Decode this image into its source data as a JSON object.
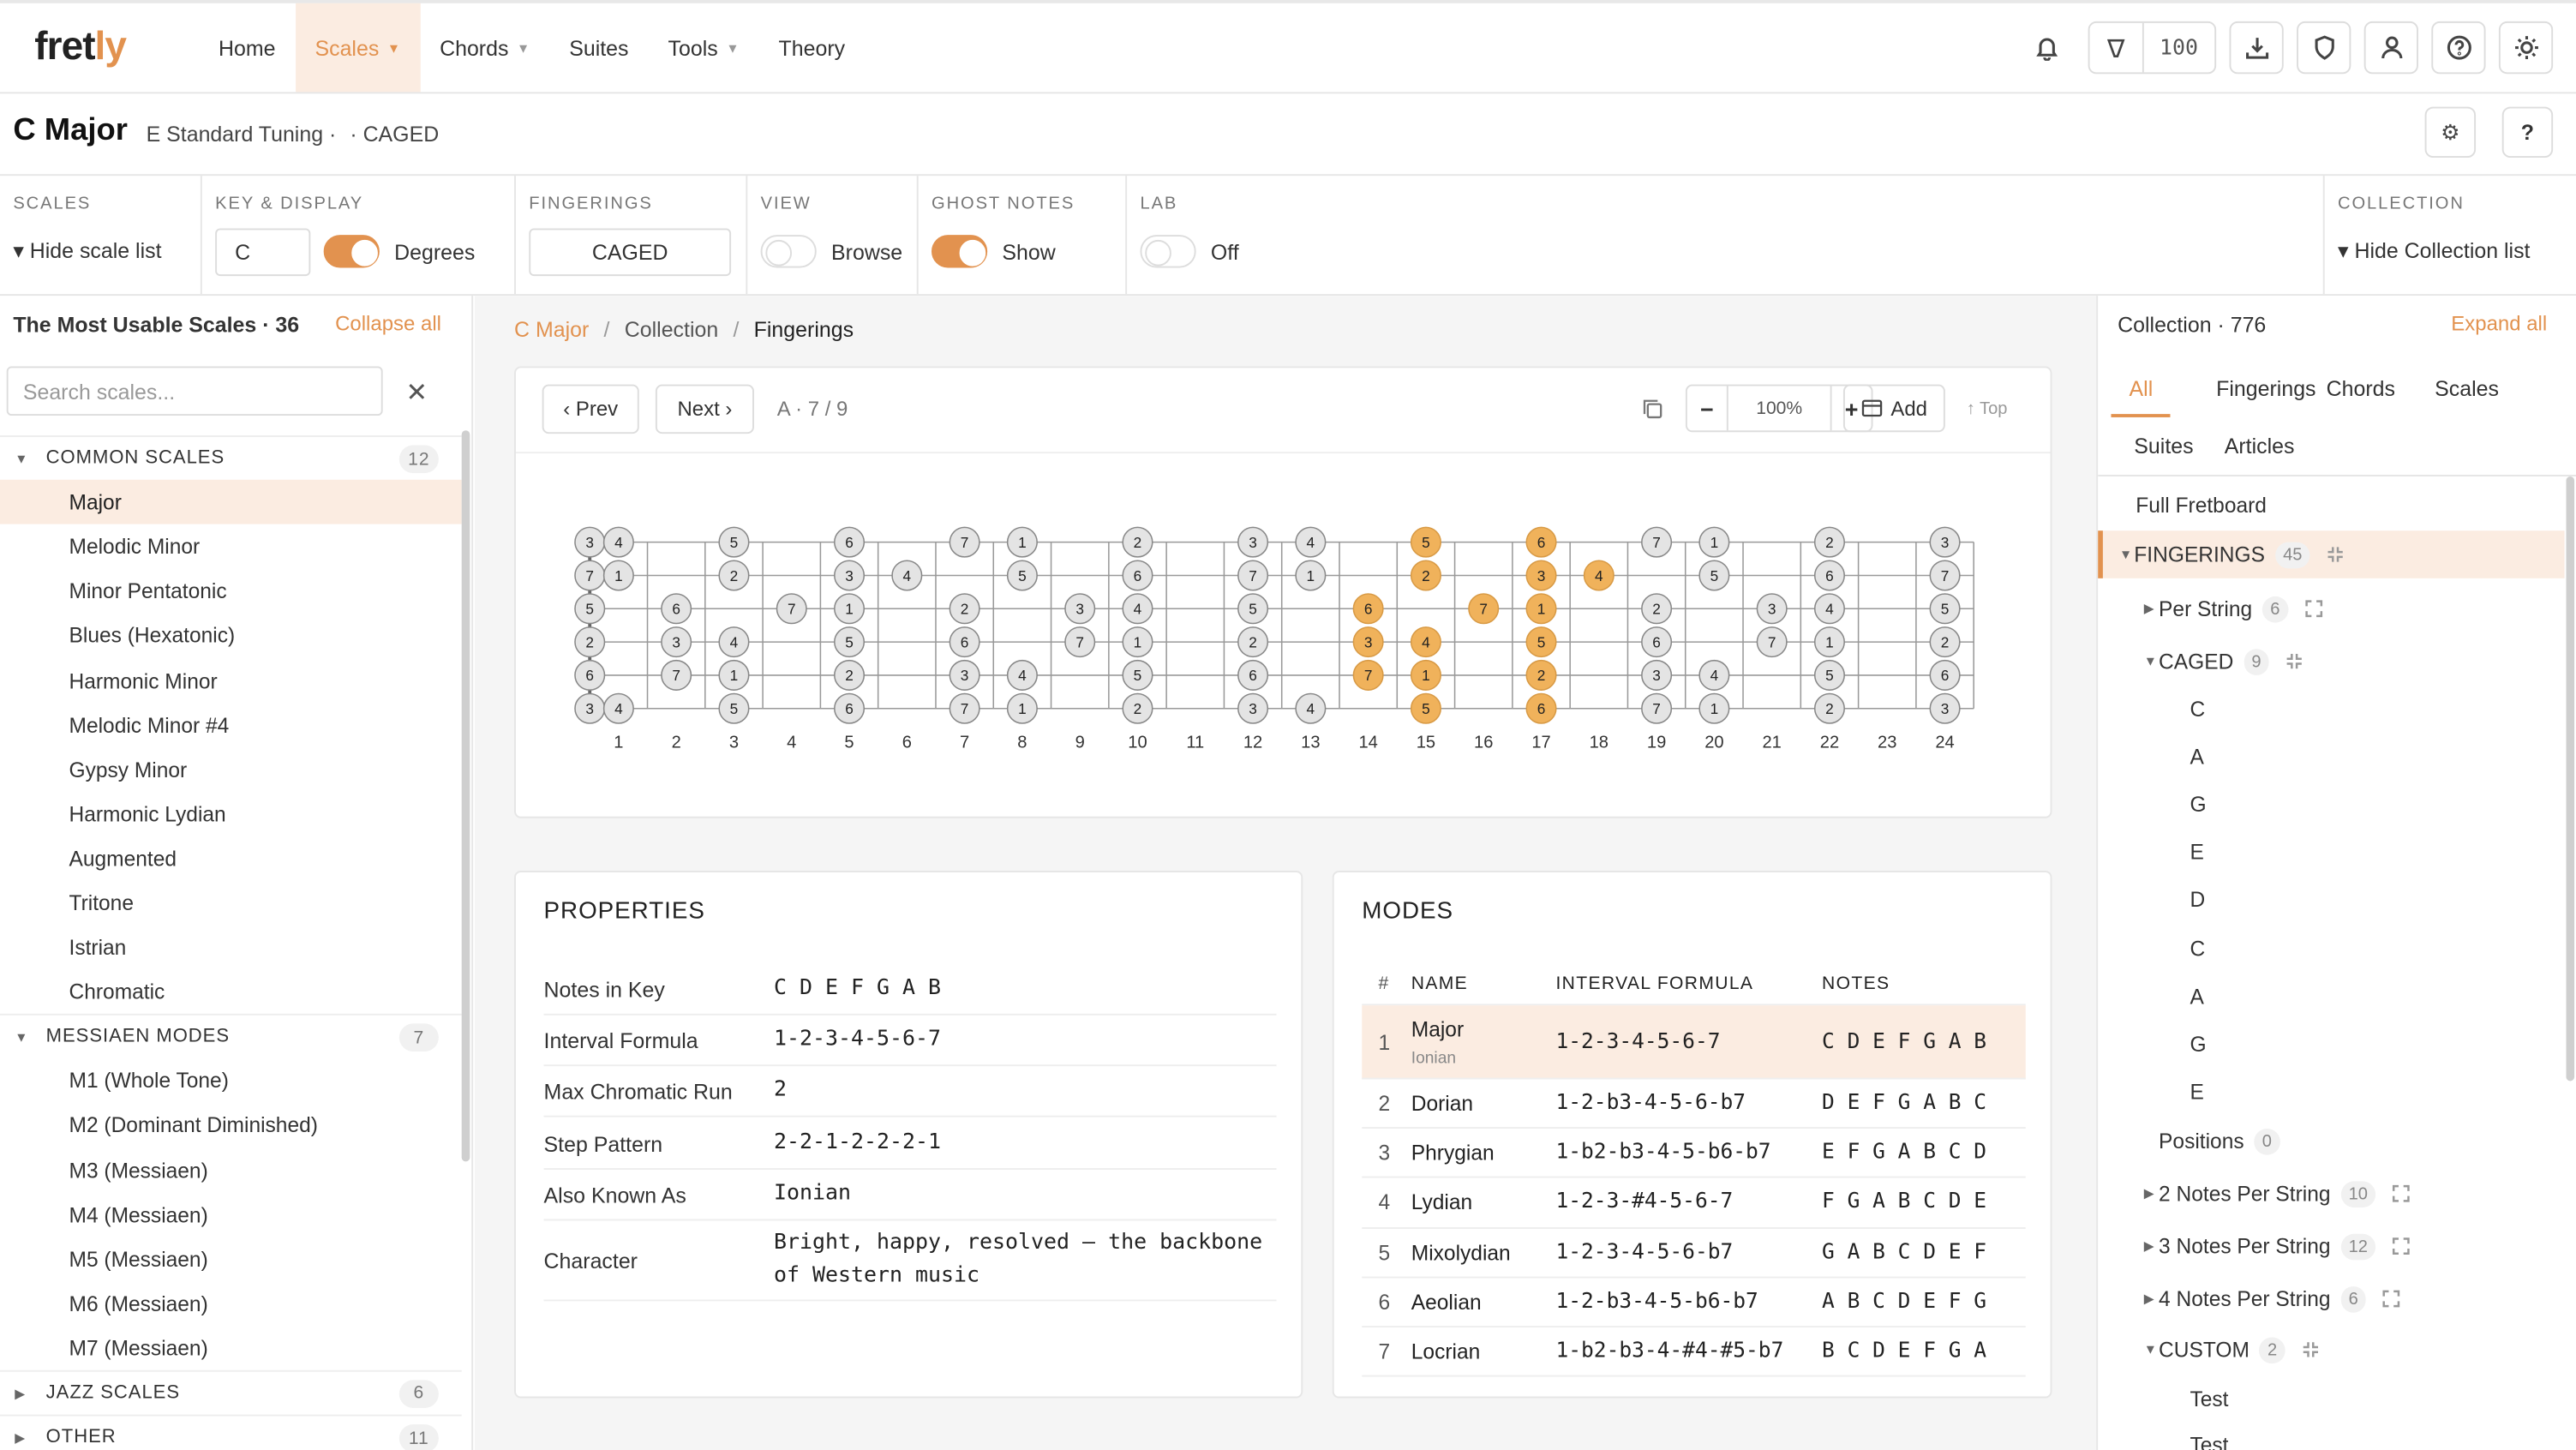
{
  "nav": {
    "logo_a": "fret",
    "logo_b": "ly",
    "items": [
      {
        "label": "Home",
        "active": false,
        "caret": false
      },
      {
        "label": "Scales",
        "active": true,
        "caret": true
      },
      {
        "label": "Chords",
        "active": false,
        "caret": true
      },
      {
        "label": "Suites",
        "active": false,
        "caret": false
      },
      {
        "label": "Tools",
        "active": false,
        "caret": true
      },
      {
        "label": "Theory",
        "active": false,
        "caret": false
      }
    ],
    "credits": "100",
    "icons": [
      "bell-icon",
      "pick-icon",
      "download-icon",
      "shield-icon",
      "user-icon",
      "help-icon",
      "sun-icon"
    ]
  },
  "title": {
    "name": "C Major",
    "tuning": "E Standard Tuning ·",
    "system": "· CAGED",
    "help": "?"
  },
  "controls": {
    "scales_label": "SCALES",
    "hide_scale_list": "▾ Hide scale list",
    "key_label": "KEY & DISPLAY",
    "key_value": "C",
    "degrees": "Degrees",
    "fingerings_label": "FINGERINGS",
    "fingerings_value": "CAGED",
    "view_label": "VIEW",
    "view_value": "Browse",
    "ghost_label": "GHOST NOTES",
    "ghost_value": "Show",
    "lab_label": "LAB",
    "lab_value": "Off",
    "collection_label": "COLLECTION",
    "hide_collection": "▾ Hide Collection list"
  },
  "left": {
    "heading": "The Most Usable Scales · 36",
    "collapse": "Collapse all",
    "search_placeholder": "Search scales...",
    "rows": [
      {
        "type": "sec",
        "label": "COMMON SCALES",
        "count": "12",
        "open": true
      },
      {
        "type": "item",
        "label": "Major",
        "selected": true
      },
      {
        "type": "item",
        "label": "Melodic Minor"
      },
      {
        "type": "item",
        "label": "Minor Pentatonic"
      },
      {
        "type": "item",
        "label": "Blues (Hexatonic)"
      },
      {
        "type": "item",
        "label": "Harmonic Minor"
      },
      {
        "type": "item",
        "label": "Melodic Minor #4"
      },
      {
        "type": "item",
        "label": "Gypsy Minor"
      },
      {
        "type": "item",
        "label": "Harmonic Lydian"
      },
      {
        "type": "item",
        "label": "Augmented"
      },
      {
        "type": "item",
        "label": "Tritone"
      },
      {
        "type": "item",
        "label": "Istrian"
      },
      {
        "type": "item",
        "label": "Chromatic"
      },
      {
        "type": "sec",
        "label": "MESSIAEN MODES",
        "count": "7",
        "open": true
      },
      {
        "type": "item",
        "label": "M1 (Whole Tone)"
      },
      {
        "type": "item",
        "label": "M2 (Dominant Diminished)"
      },
      {
        "type": "item",
        "label": "M3 (Messiaen)"
      },
      {
        "type": "item",
        "label": "M4 (Messiaen)"
      },
      {
        "type": "item",
        "label": "M5 (Messiaen)"
      },
      {
        "type": "item",
        "label": "M6 (Messiaen)"
      },
      {
        "type": "item",
        "label": "M7 (Messiaen)"
      },
      {
        "type": "sec",
        "label": "JAZZ SCALES",
        "count": "6",
        "open": false
      },
      {
        "type": "sec",
        "label": "OTHER",
        "count": "11",
        "open": false
      }
    ]
  },
  "center": {
    "breadcrumb": [
      "C Major",
      "Collection",
      "Fingerings"
    ],
    "prev": "‹ Prev",
    "next": "Next ›",
    "position": "A · 7 / 9",
    "zoom": "100%",
    "zoom_minus": "−",
    "zoom_plus": "+",
    "add": "Add",
    "top": "↑ Top"
  },
  "fretboard": {
    "frets": 24,
    "fret_numbers": [
      "1",
      "2",
      "3",
      "4",
      "5",
      "6",
      "7",
      "8",
      "9",
      "10",
      "11",
      "12",
      "13",
      "14",
      "15",
      "16",
      "17",
      "18",
      "19",
      "20",
      "21",
      "22",
      "23",
      "24"
    ],
    "strings": [
      {
        "degrees": [
          "3",
          "4",
          null,
          "5",
          null,
          "6",
          null,
          "7",
          "1",
          null,
          "2",
          null,
          "3",
          "4",
          null,
          "5",
          null,
          "6",
          null,
          "7",
          "1",
          null,
          "2",
          null,
          "3"
        ]
      },
      {
        "degrees": [
          "7",
          "1",
          null,
          "2",
          null,
          "3",
          "4",
          null,
          "5",
          null,
          "6",
          null,
          "7",
          "1",
          null,
          "2",
          null,
          "3",
          "4",
          null,
          "5",
          null,
          "6",
          null,
          "7"
        ]
      },
      {
        "degrees": [
          "5",
          null,
          "6",
          null,
          "7",
          "1",
          null,
          "2",
          null,
          "3",
          "4",
          null,
          "5",
          null,
          "6",
          null,
          "7",
          "1",
          null,
          "2",
          null,
          "3",
          "4",
          null,
          "5"
        ]
      },
      {
        "degrees": [
          "2",
          null,
          "3",
          "4",
          null,
          "5",
          null,
          "6",
          null,
          "7",
          "1",
          null,
          "2",
          null,
          "3",
          "4",
          null,
          "5",
          null,
          "6",
          null,
          "7",
          "1",
          null,
          "2"
        ]
      },
      {
        "degrees": [
          "6",
          null,
          "7",
          "1",
          null,
          "2",
          null,
          "3",
          "4",
          null,
          "5",
          null,
          "6",
          null,
          "7",
          "1",
          null,
          "2",
          null,
          "3",
          "4",
          null,
          "5",
          null,
          "6"
        ]
      },
      {
        "degrees": [
          "3",
          "4",
          null,
          "5",
          null,
          "6",
          null,
          "7",
          "1",
          null,
          "2",
          null,
          "3",
          "4",
          null,
          "5",
          null,
          "6",
          null,
          "7",
          "1",
          null,
          "2",
          null,
          "3"
        ]
      }
    ],
    "highlighted": [
      [
        0,
        15
      ],
      [
        0,
        17
      ],
      [
        1,
        15
      ],
      [
        1,
        17
      ],
      [
        1,
        18
      ],
      [
        2,
        14
      ],
      [
        2,
        16
      ],
      [
        2,
        17
      ],
      [
        3,
        14
      ],
      [
        3,
        15
      ],
      [
        3,
        17
      ],
      [
        4,
        14
      ],
      [
        4,
        15
      ],
      [
        4,
        17
      ],
      [
        5,
        15
      ],
      [
        5,
        17
      ]
    ],
    "highlight_color": "#f0b25b",
    "ghost_color": "#e4e4e4"
  },
  "properties": {
    "title": "PROPERTIES",
    "rows": [
      {
        "k": "Notes in Key",
        "v": "C D E F G A B"
      },
      {
        "k": "Interval Formula",
        "v": "1-2-3-4-5-6-7"
      },
      {
        "k": "Max Chromatic Run",
        "v": "2"
      },
      {
        "k": "Step Pattern",
        "v": "2-2-1-2-2-2-1"
      },
      {
        "k": "Also Known As",
        "v": "Ionian"
      },
      {
        "k": "Character",
        "v": "Bright, happy, resolved — the backbone of Western music"
      }
    ]
  },
  "modes": {
    "title": "MODES",
    "headers": [
      "#",
      "NAME",
      "INTERVAL FORMULA",
      "NOTES"
    ],
    "rows": [
      {
        "n": "1",
        "name": "Major",
        "sub": "Ionian",
        "formula": "1-2-3-4-5-6-7",
        "notes": "C D E F G A B",
        "selected": true
      },
      {
        "n": "2",
        "name": "Dorian",
        "sub": "",
        "formula": "1-2-b3-4-5-6-b7",
        "notes": "D E F G A B C"
      },
      {
        "n": "3",
        "name": "Phrygian",
        "sub": "",
        "formula": "1-b2-b3-4-5-b6-b7",
        "notes": "E F G A B C D"
      },
      {
        "n": "4",
        "name": "Lydian",
        "sub": "",
        "formula": "1-2-3-#4-5-6-7",
        "notes": "F G A B C D E"
      },
      {
        "n": "5",
        "name": "Mixolydian",
        "sub": "",
        "formula": "1-2-3-4-5-6-b7",
        "notes": "G A B C D E F"
      },
      {
        "n": "6",
        "name": "Aeolian",
        "sub": "",
        "formula": "1-2-b3-4-5-b6-b7",
        "notes": "A B C D E F G"
      },
      {
        "n": "7",
        "name": "Locrian",
        "sub": "",
        "formula": "1-b2-b3-4-#4-#5-b7",
        "notes": "B C D E F G A"
      }
    ]
  },
  "right": {
    "heading": "Collection · 776",
    "expand": "Expand all",
    "tabs": [
      "All",
      "Fingerings",
      "Chords",
      "Scales",
      "Suites",
      "Articles"
    ],
    "tree": [
      {
        "label": "Full Fretboard",
        "indent": 0,
        "arrow": "",
        "badge": "",
        "icon": ""
      },
      {
        "label": "FINGERINGS",
        "indent": 1,
        "arrow": "▼",
        "badge": "45",
        "icon": "collapse",
        "hl": true
      },
      {
        "label": "Per String",
        "indent": 2,
        "arrow": "▶",
        "badge": "6",
        "icon": "expand"
      },
      {
        "label": "CAGED",
        "indent": 2,
        "arrow": "▼",
        "badge": "9",
        "icon": "collapse"
      },
      {
        "label": "C",
        "indent": 3
      },
      {
        "label": "A",
        "indent": 3
      },
      {
        "label": "G",
        "indent": 3
      },
      {
        "label": "E",
        "indent": 3
      },
      {
        "label": "D",
        "indent": 3
      },
      {
        "label": "C",
        "indent": 3
      },
      {
        "label": "A",
        "indent": 3
      },
      {
        "label": "G",
        "indent": 3
      },
      {
        "label": "E",
        "indent": 3
      },
      {
        "label": "Positions",
        "indent": 2,
        "arrow": "",
        "badge": "0"
      },
      {
        "label": "2 Notes Per String",
        "indent": 2,
        "arrow": "▶",
        "badge": "10",
        "icon": "expand"
      },
      {
        "label": "3 Notes Per String",
        "indent": 2,
        "arrow": "▶",
        "badge": "12",
        "icon": "expand"
      },
      {
        "label": "4 Notes Per String",
        "indent": 2,
        "arrow": "▶",
        "badge": "6",
        "icon": "expand"
      },
      {
        "label": "CUSTOM",
        "indent": 2,
        "arrow": "▼",
        "badge": "2",
        "icon": "collapse"
      },
      {
        "label": "Test",
        "indent": 3
      },
      {
        "label": "Test",
        "indent": 3
      }
    ]
  }
}
